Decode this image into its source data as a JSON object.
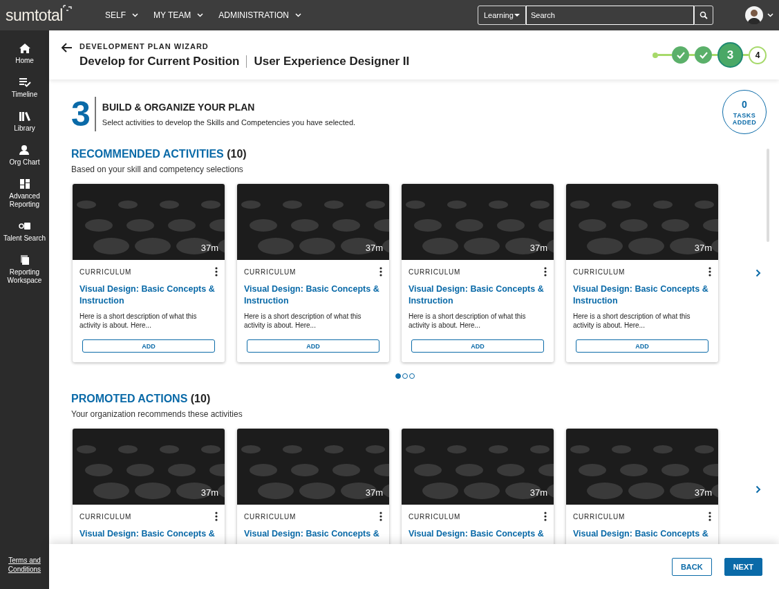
{
  "top_bar": {
    "logo": "sumtotal",
    "menus": [
      {
        "label": "SELF"
      },
      {
        "label": "MY TEAM"
      },
      {
        "label": "ADMINISTRATION"
      }
    ],
    "search": {
      "scope": "Learning",
      "placeholder": "Search"
    }
  },
  "sidebar": {
    "items": [
      {
        "label": "Home"
      },
      {
        "label": "Timeline"
      },
      {
        "label": "Library"
      },
      {
        "label": "Org Chart"
      },
      {
        "label": "Advanced Reporting"
      },
      {
        "label": "Talent Search"
      },
      {
        "label": "Reporting Workspace"
      }
    ],
    "footer_link": "Terms and Conditions"
  },
  "header": {
    "eyebrow": "DEVELOPMENT PLAN WIZARD",
    "title": "Develop for Current Position",
    "subtitle": "User Experience Designer II",
    "steps": [
      {
        "done": true,
        "selected": false
      },
      {
        "done": true,
        "selected": false
      },
      {
        "done": false,
        "selected": true,
        "label": "3"
      },
      {
        "done": false,
        "selected": false,
        "label": "4"
      }
    ]
  },
  "intro": {
    "number": "3",
    "title": "BUILD & ORGANIZE YOUR PLAN",
    "text": "Select activities to develop the Skills and Competencies you have selected."
  },
  "tasks_counter": {
    "count": "0",
    "label": "TASKS ADDED"
  },
  "sections": [
    {
      "title": "RECOMMENDED ACTIVITIES",
      "count": "(10)",
      "subtitle": "Based on your skill and competency selections",
      "cards": [
        {
          "duration": "37m",
          "type": "CURRICULUM",
          "title": "Visual Design: Basic Concepts & Instruction",
          "description": "Here is a short description of what this activity is about. Here...",
          "button": "ADD"
        },
        {
          "duration": "37m",
          "type": "CURRICULUM",
          "title": "Visual Design: Basic Concepts & Instruction",
          "description": "Here is a short description of what this activity is about. Here...",
          "button": "ADD"
        },
        {
          "duration": "37m",
          "type": "CURRICULUM",
          "title": "Visual Design: Basic Concepts & Instruction",
          "description": "Here is a short description of what this activity is about. Here...",
          "button": "ADD"
        },
        {
          "duration": "37m",
          "type": "CURRICULUM",
          "title": "Visual Design: Basic Concepts & Instruction",
          "description": "Here is a short description of what this activity is about. Here...",
          "button": "ADD"
        }
      ],
      "pager": [
        {
          "selected": true
        },
        {
          "selected": false
        },
        {
          "selected": false
        }
      ]
    },
    {
      "title": "PROMOTED ACTIONS",
      "count": "(10)",
      "subtitle": "Your organization recommends these activities",
      "cards": [
        {
          "duration": "37m",
          "type": "CURRICULUM",
          "title": "Visual Design: Basic Concepts &"
        },
        {
          "duration": "37m",
          "type": "CURRICULUM",
          "title": "Visual Design: Basic Concepts &"
        },
        {
          "duration": "37m",
          "type": "CURRICULUM",
          "title": "Visual Design: Basic Concepts &"
        },
        {
          "duration": "37m",
          "type": "CURRICULUM",
          "title": "Visual Design: Basic Concepts &"
        }
      ]
    }
  ],
  "footer": {
    "buttons": [
      {
        "label": "BACK",
        "kind": "secondary"
      },
      {
        "label": "NEXT",
        "kind": "primary"
      }
    ]
  }
}
